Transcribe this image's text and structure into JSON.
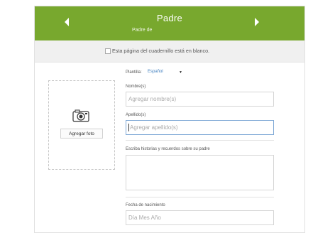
{
  "header": {
    "title": "Padre",
    "subtitle": "Padre de",
    "prev_icon": "chevron-left-icon",
    "next_icon": "chevron-right-icon",
    "color": "#78a82e"
  },
  "notice": {
    "checked": false,
    "label": "Esta página del cuadernillo está en blanco."
  },
  "photo": {
    "icon": "camera-icon",
    "button_label": "Agregar foto"
  },
  "form": {
    "template_label": "Plantilla:",
    "template_value": "Español",
    "first_name_label": "Nombre(s)",
    "first_name_placeholder": "Agregar nombre(s)",
    "last_name_label": "Apellido(s)",
    "last_name_placeholder": "Agregar apellido(s)",
    "stories_label": "Escriba historias y recuerdos sobre su padre",
    "birth_label": "Fecha de nacimiento",
    "birth_placeholder": "Día Mes Año"
  }
}
